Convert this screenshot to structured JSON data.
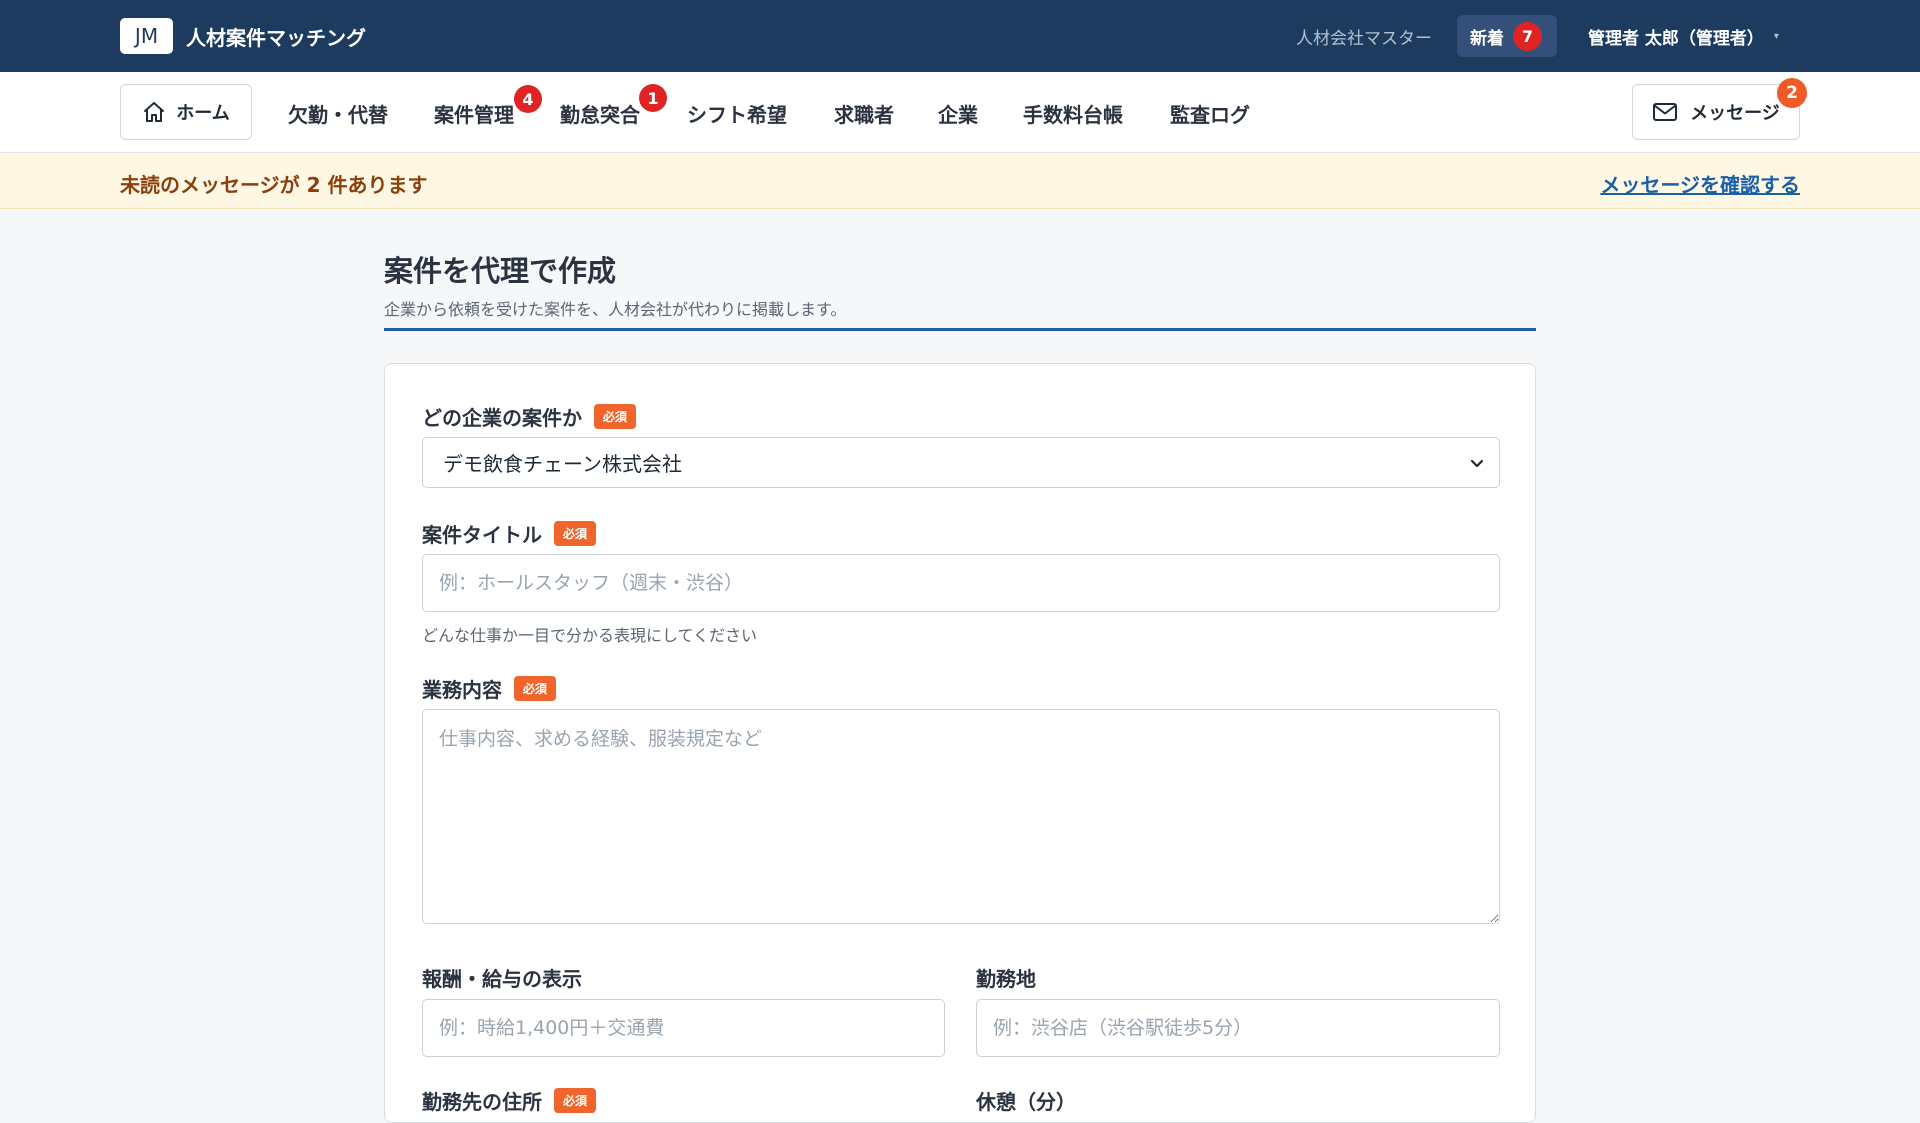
{
  "topbar": {
    "logo": "JM",
    "app_name": "人材案件マッチング",
    "company": "人材会社マスター",
    "new_label": "新着",
    "new_count": "7",
    "user": "管理者 太郎（管理者）",
    "caret": "▾"
  },
  "nav": {
    "home": "ホーム",
    "items": [
      {
        "label": "欠勤・代替",
        "badge": ""
      },
      {
        "label": "案件管理",
        "badge": "4"
      },
      {
        "label": "勤怠突合",
        "badge": "1"
      },
      {
        "label": "シフト希望",
        "badge": ""
      },
      {
        "label": "求職者",
        "badge": ""
      },
      {
        "label": "企業",
        "badge": ""
      },
      {
        "label": "手数料台帳",
        "badge": ""
      },
      {
        "label": "監査ログ",
        "badge": ""
      }
    ],
    "messages": "メッセージ",
    "messages_badge": "2"
  },
  "notice": {
    "text": "未読のメッセージが 2 件あります",
    "link": "メッセージを確認する"
  },
  "page": {
    "title": "案件を代理で作成",
    "subtitle": "企業から依頼を受けた案件を、人材会社が代わりに掲載します。"
  },
  "form": {
    "required": "必須",
    "company": {
      "label": "どの企業の案件か",
      "value": "デモ飲食チェーン株式会社"
    },
    "title": {
      "label": "案件タイトル",
      "placeholder": "例：ホールスタッフ（週末・渋谷）",
      "help": "どんな仕事か一目で分かる表現にしてください"
    },
    "description": {
      "label": "業務内容",
      "placeholder": "仕事内容、求める経験、服装規定など"
    },
    "pay": {
      "label": "報酬・給与の表示",
      "placeholder": "例：時給1,400円＋交通費"
    },
    "location": {
      "label": "勤務地",
      "placeholder": "例：渋谷店（渋谷駅徒歩5分）"
    },
    "address": {
      "label": "勤務先の住所"
    },
    "break": {
      "label": "休憩（分）"
    }
  },
  "colors": {
    "topbar": "#1d3a5f",
    "badge_red": "#e02424",
    "badge_orange": "#f05a26",
    "required_tag": "#f0652c",
    "link": "#1b5fa6",
    "notice_bg": "#fdf7e3"
  },
  "icons": {
    "home": "home-icon",
    "mail": "mail-icon",
    "chevron": "chevron-down-icon"
  }
}
